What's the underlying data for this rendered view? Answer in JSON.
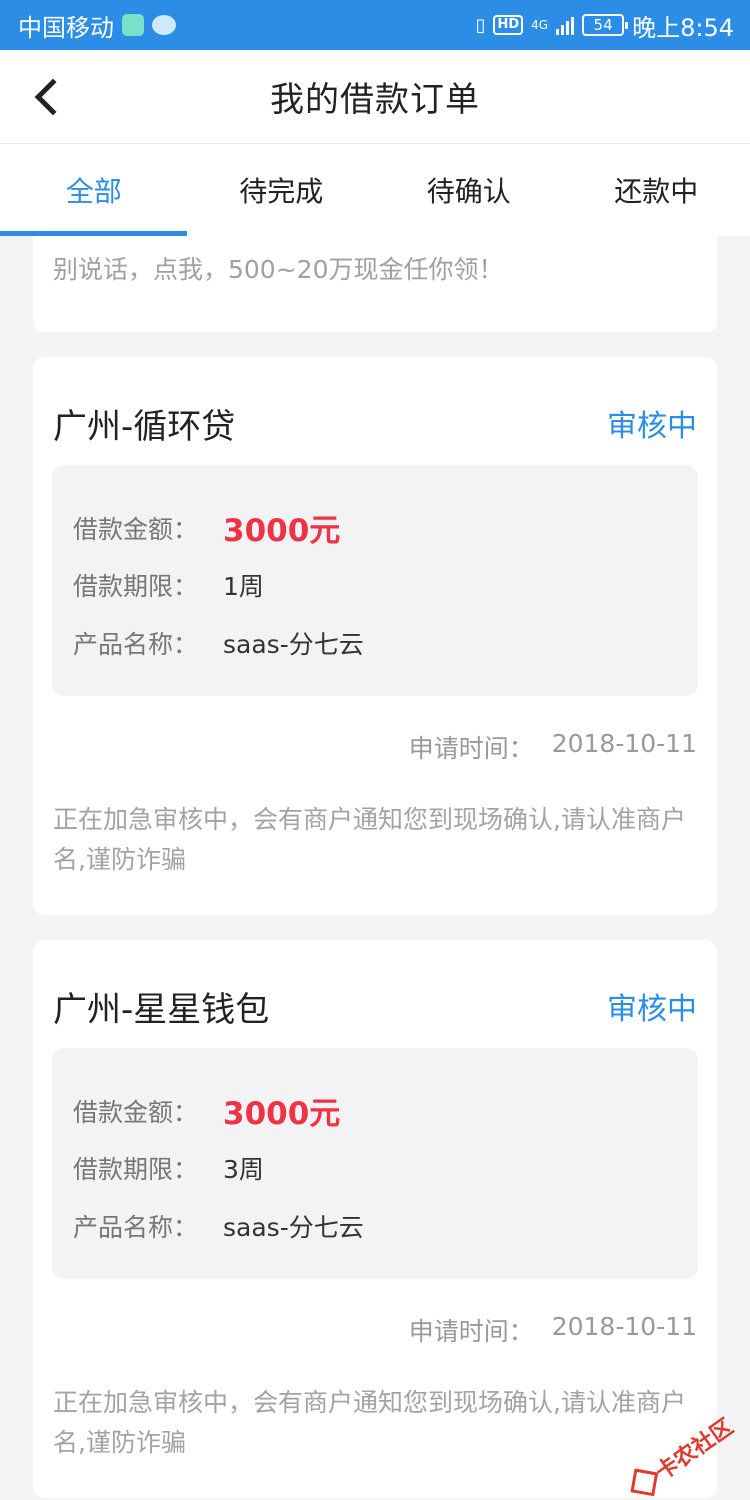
{
  "status_bar": {
    "carrier": "中国移动",
    "hd": "HD",
    "network": "4G",
    "battery": "54",
    "time": "晚上8:54"
  },
  "header": {
    "title": "我的借款订单"
  },
  "tabs": [
    {
      "label": "全部",
      "active": true
    },
    {
      "label": "待完成",
      "active": false
    },
    {
      "label": "待确认",
      "active": false
    },
    {
      "label": "还款中",
      "active": false
    }
  ],
  "banner": {
    "text": "别说话，点我，500~20万现金任你领！"
  },
  "labels": {
    "amount": "借款金额：",
    "term": "借款期限：",
    "product": "产品名称：",
    "apply_time": "申请时间："
  },
  "orders": [
    {
      "title": "广州-循环贷",
      "status": "审核中",
      "amount": "3000元",
      "term": "1周",
      "product": "saas-分七云",
      "apply_time": "2018-10-11",
      "note": "正在加急审核中，会有商户通知您到现场确认,请认准商户名,谨防诈骗"
    },
    {
      "title": "广州-星星钱包",
      "status": "审核中",
      "amount": "3000元",
      "term": "3周",
      "product": "saas-分七云",
      "apply_time": "2018-10-11",
      "note": "正在加急审核中，会有商户通知您到现场确认,请认准商户名,谨防诈骗"
    }
  ],
  "watermark": {
    "text": "卡农社区"
  }
}
